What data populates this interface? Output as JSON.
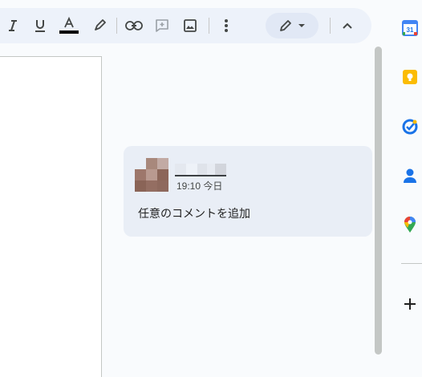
{
  "toolbar": {
    "buttons": [
      "italic",
      "underline",
      "text-color",
      "highlight",
      "insert-link",
      "add-comment",
      "insert-image",
      "more-options"
    ],
    "text_color_value": "#000000",
    "mode_icon": "pencil-icon",
    "collapse_icon": "chevron-up-icon"
  },
  "comment": {
    "time": "19:10 今日",
    "placeholder": "任意のコメントを追加"
  },
  "side_panel": {
    "apps": [
      "calendar-icon",
      "keep-icon",
      "tasks-icon",
      "contacts-icon",
      "maps-icon"
    ],
    "calendar_day": "31",
    "add_icon": "plus-icon"
  },
  "colors": {
    "toolbar_bg": "#edf2fa",
    "comment_bg": "#e9eef6",
    "calendar_blue": "#4285f4",
    "keep_yellow": "#fbbc04",
    "tasks_blue": "#1a73e8"
  }
}
